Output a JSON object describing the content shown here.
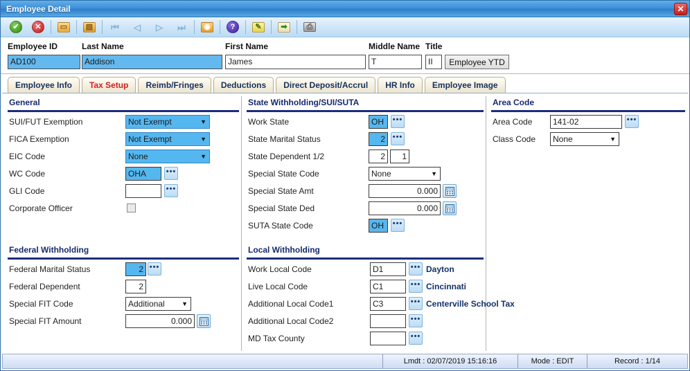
{
  "window": {
    "title": "Employee Detail",
    "close_label": "✕",
    "accent_blue": "#3f90d8",
    "section_rule_color": "#1b2d80",
    "highlight_color": "#55b7f0"
  },
  "toolbar": {
    "buttons": [
      {
        "name": "accept-icon",
        "label": "Accept",
        "glyph": "✔",
        "fg": "#ffffff",
        "bg1": "#7fd04f",
        "bg2": "#2e8b15",
        "shape": "circle"
      },
      {
        "name": "cancel-icon",
        "label": "Cancel",
        "glyph": "✕",
        "fg": "#ffffff",
        "bg1": "#f07a7a",
        "bg2": "#c01414",
        "shape": "circle"
      },
      {
        "name": "open-folder-icon",
        "label": "Open",
        "glyph": "▭",
        "fg": "#8a5a10",
        "bg1": "#ffd98a",
        "bg2": "#e8a83c",
        "shape": "folder"
      },
      {
        "name": "copy-icon",
        "label": "Copy",
        "glyph": "▧",
        "fg": "#8a5a10",
        "bg1": "#ffd98a",
        "bg2": "#dc9a2c",
        "shape": "folder"
      },
      {
        "name": "first-record-icon",
        "label": "First",
        "glyph": "⏮",
        "fg": "#89b6d8",
        "bg1": "",
        "bg2": "",
        "shape": "nav"
      },
      {
        "name": "prev-record-icon",
        "label": "Previous",
        "glyph": "◁",
        "fg": "#89b6d8",
        "bg1": "",
        "bg2": "",
        "shape": "nav"
      },
      {
        "name": "next-record-icon",
        "label": "Next",
        "glyph": "▷",
        "fg": "#89b6d8",
        "bg1": "",
        "bg2": "",
        "shape": "nav"
      },
      {
        "name": "last-record-icon",
        "label": "Last",
        "glyph": "⏭",
        "fg": "#89b6d8",
        "bg1": "",
        "bg2": "",
        "shape": "nav"
      },
      {
        "name": "camera-icon",
        "label": "Photo",
        "glyph": "◉",
        "fg": "#ffffff",
        "bg1": "#ffd27a",
        "bg2": "#e79a25",
        "shape": "camera"
      },
      {
        "name": "help-icon",
        "label": "Help",
        "glyph": "?",
        "fg": "#ffffff",
        "bg1": "#8c6fe0",
        "bg2": "#3b1e9e",
        "shape": "circle"
      },
      {
        "name": "edit-note-icon",
        "label": "Notes",
        "glyph": "✎",
        "fg": "#4a7a16",
        "bg1": "#fff3a8",
        "bg2": "#e8d445",
        "shape": "page"
      },
      {
        "name": "export-icon",
        "label": "Export",
        "glyph": "➡",
        "fg": "#2e8b15",
        "bg1": "#fffbe6",
        "bg2": "#ece0b0",
        "shape": "page"
      },
      {
        "name": "print-icon",
        "label": "Print",
        "glyph": "⎙",
        "fg": "#5a5a5a",
        "bg1": "#e6e6e6",
        "bg2": "#9a9a9a",
        "shape": "printer"
      }
    ]
  },
  "header": {
    "employee_id": {
      "label": "Employee ID",
      "value": "AD100",
      "selected": true
    },
    "last_name": {
      "label": "Last Name",
      "value": "Addison",
      "selected": true
    },
    "first_name": {
      "label": "First Name",
      "value": "James",
      "selected": false
    },
    "middle_name": {
      "label": "Middle Name",
      "value": "T",
      "selected": false
    },
    "title": {
      "label": "Title",
      "value": "II",
      "selected": false
    },
    "ytd_button": {
      "label": "Employee YTD"
    }
  },
  "tabs": [
    {
      "label": "Employee Info",
      "active": false
    },
    {
      "label": "Tax Setup",
      "active": true
    },
    {
      "label": "Reimb/Fringes",
      "active": false
    },
    {
      "label": "Deductions",
      "active": false
    },
    {
      "label": "Direct Deposit/Accrul",
      "active": false
    },
    {
      "label": "HR Info",
      "active": false
    },
    {
      "label": "Employee Image",
      "active": false
    }
  ],
  "sections": {
    "general": {
      "title": "General",
      "fields": {
        "sui_fut_exemption": {
          "label": "SUI/FUT Exemption",
          "value": "Not Exempt"
        },
        "fica_exemption": {
          "label": "FICA Exemption",
          "value": "Not Exempt"
        },
        "eic_code": {
          "label": "EIC Code",
          "value": "None"
        },
        "wc_code": {
          "label": "WC Code",
          "value": "OHA"
        },
        "gli_code": {
          "label": "GLI Code",
          "value": ""
        },
        "corporate_officer": {
          "label": "Corporate Officer",
          "checked": false
        }
      }
    },
    "state_withholding": {
      "title": "State Withholding/SUI/SUTA",
      "fields": {
        "work_state": {
          "label": "Work State",
          "value": "OH"
        },
        "state_marital_status": {
          "label": "State Marital Status",
          "value": "2"
        },
        "state_dependent": {
          "label": "State Dependent 1/2",
          "value1": "2",
          "value2": "1"
        },
        "special_state_code": {
          "label": "Special State Code",
          "value": "None"
        },
        "special_state_amt": {
          "label": "Special State Amt",
          "value": "0.000"
        },
        "special_state_ded": {
          "label": "Special State Ded",
          "value": "0.000"
        },
        "suta_state_code": {
          "label": "SUTA State Code",
          "value": "OH"
        }
      }
    },
    "area_code": {
      "title": "Area Code",
      "fields": {
        "area_code": {
          "label": "Area Code",
          "value": "141-02"
        },
        "class_code": {
          "label": "Class Code",
          "value": "None"
        }
      }
    },
    "federal_withholding": {
      "title": "Federal Withholding",
      "fields": {
        "federal_marital_status": {
          "label": "Federal Marital Status",
          "value": "2"
        },
        "federal_dependent": {
          "label": "Federal Dependent",
          "value": "2"
        },
        "special_fit_code": {
          "label": "Special FIT Code",
          "value": "Additional"
        },
        "special_fit_amount": {
          "label": "Special FIT Amount",
          "value": "0.000"
        }
      }
    },
    "local_withholding": {
      "title": "Local Withholding",
      "fields": {
        "work_local_code": {
          "label": "Work Local Code",
          "value": "D1",
          "desc": "Dayton"
        },
        "live_local_code": {
          "label": "Live Local Code",
          "value": "C1",
          "desc": "Cincinnati"
        },
        "additional_local_code1": {
          "label": "Additional Local Code1",
          "value": "C3",
          "desc": "Centerville School Tax"
        },
        "additional_local_code2": {
          "label": "Additional Local Code2",
          "value": "",
          "desc": ""
        },
        "md_tax_county": {
          "label": "MD Tax County",
          "value": "",
          "desc": ""
        }
      }
    }
  },
  "statusbar": {
    "last_modified": "Lmdt : 02/07/2019 15:16:16",
    "mode": "Mode : EDIT",
    "record": "Record : 1/14"
  },
  "ellipsis_label": "•••",
  "caret_label": "▼"
}
